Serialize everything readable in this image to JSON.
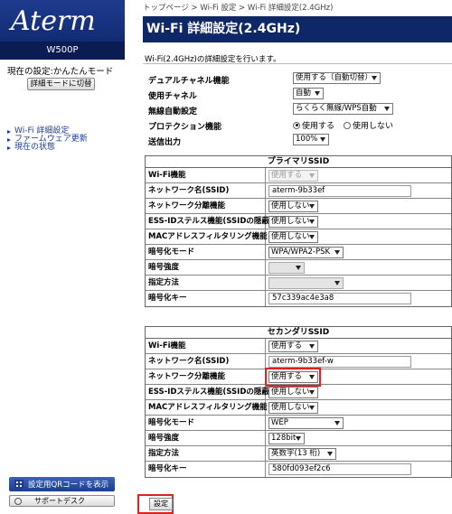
{
  "sidebar": {
    "logo": "Aterm",
    "model": "W500P",
    "mode_text": "現在の設定:かんたんモード",
    "mode_button": "詳細モードに切替",
    "nav": [
      "Wi-Fi 詳細設定",
      "ファームウェア更新",
      "現在の状態"
    ],
    "qr_button": "設定用QRコードを表示",
    "support_button": "サポートデスク"
  },
  "breadcrumb": "トップページ > Wi-Fi 設定 > Wi-Fi 詳細設定(2.4GHz)",
  "page_title": "Wi-Fi 詳細設定(2.4GHz)",
  "description": "Wi-Fi(2.4GHz)の詳細設定を行います。",
  "general": {
    "dual_channel": {
      "label": "デュアルチャネル機能",
      "value": "使用する（自動切替）"
    },
    "channel": {
      "label": "使用チャネル",
      "value": "自動"
    },
    "wireless_auto": {
      "label": "無線自動設定",
      "value": "らくらく無線/WPS自動"
    },
    "protection": {
      "label": "プロテクション機能",
      "options": [
        "使用する",
        "使用しない"
      ],
      "selected": "使用する"
    },
    "tx_power": {
      "label": "送信出力",
      "value": "100%"
    }
  },
  "primary": {
    "header": "プライマリSSID",
    "rows": [
      {
        "label": "Wi-Fi機能",
        "value": "使用する"
      },
      {
        "label": "ネットワーク名(SSID)",
        "value": "aterm-9b33ef"
      },
      {
        "label": "ネットワーク分離機能",
        "value": "使用しない"
      },
      {
        "label": "ESS-IDステルス機能(SSIDの隠蔽)",
        "value": "使用しない"
      },
      {
        "label": "MACアドレスフィルタリング機能",
        "value": "使用しない"
      },
      {
        "label": "暗号化モード",
        "value": "WPA/WPA2-PSK"
      },
      {
        "label": "暗号強度",
        "value": ""
      },
      {
        "label": "指定方法",
        "value": ""
      },
      {
        "label": "暗号化キー",
        "value": "57c339ac4e3a8"
      }
    ]
  },
  "secondary": {
    "header": "セカンダリSSID",
    "rows": [
      {
        "label": "Wi-Fi機能",
        "value": "使用する"
      },
      {
        "label": "ネットワーク名(SSID)",
        "value": "aterm-9b33ef-w"
      },
      {
        "label": "ネットワーク分離機能",
        "value": "使用する"
      },
      {
        "label": "ESS-IDステルス機能(SSIDの隠蔽)",
        "value": "使用しない"
      },
      {
        "label": "MACアドレスフィルタリング機能",
        "value": "使用しない"
      },
      {
        "label": "暗号化モード",
        "value": "WEP"
      },
      {
        "label": "暗号強度",
        "value": "128bit"
      },
      {
        "label": "指定方法",
        "value": "英数字(13 桁)"
      },
      {
        "label": "暗号化キー",
        "value": "580fd093ef2c6"
      }
    ]
  },
  "set_button": "設定",
  "colors": {
    "title_bar": "#0e2766",
    "highlight": "#e02020",
    "link": "#1a3c9c"
  }
}
